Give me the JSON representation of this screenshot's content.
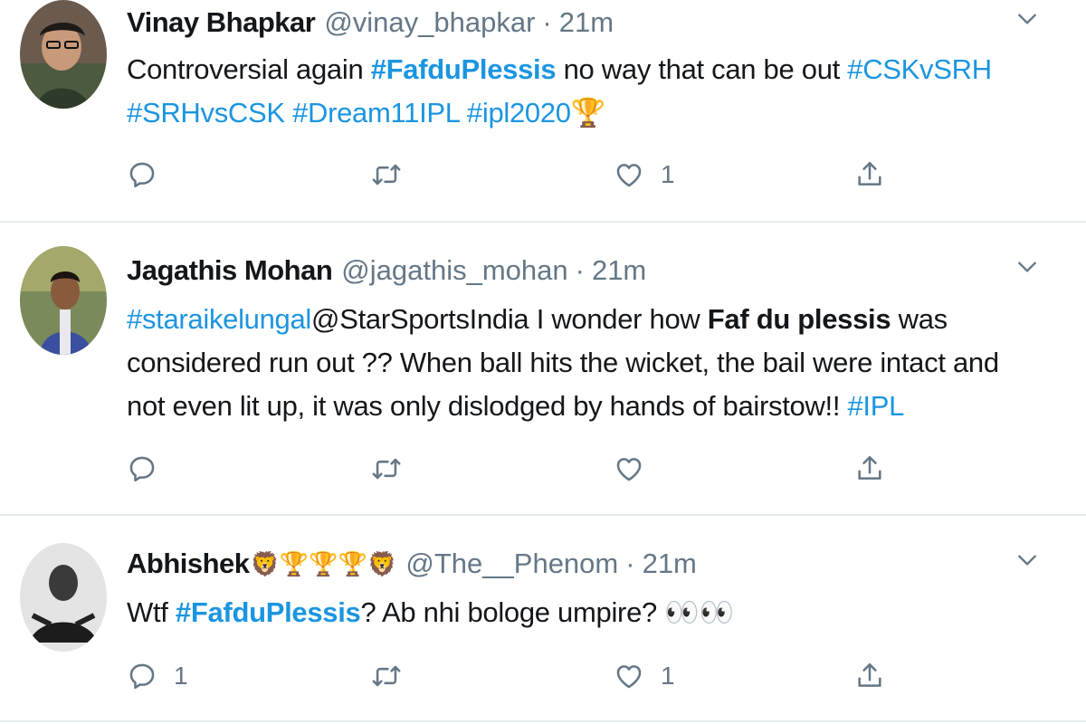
{
  "tweets": [
    {
      "name": "Vinay Bhapkar",
      "name_emoji": "",
      "handle": "@vinay_bhapkar",
      "separator": "·",
      "time": "21m",
      "text": {
        "p1": "Controversial again ",
        "h1": "#FafduPlessis",
        "p2": " no way that can be out ",
        "h2": "#CSKvSRH",
        "h3": "#SRHvsCSK",
        "h4": "#Dream11IPL",
        "h5": "#ipl2020",
        "emoji": "🏆"
      },
      "reply_count": "",
      "retweet_count": "",
      "like_count": "1"
    },
    {
      "name": "Jagathis Mohan",
      "handle": "@jagathis_mohan",
      "separator": "·",
      "time": "21m",
      "text": {
        "h1": "#staraikelungal",
        "mention": "@StarSportsIndia",
        "p1": " I wonder how ",
        "b1": "Faf du plessis",
        "p2": " was considered run out ?? When ball hits the wicket, the bail were intact and not even lit up, it was only dislodged by hands of bairstow!! ",
        "h2": "#IPL"
      },
      "reply_count": "",
      "retweet_count": "",
      "like_count": ""
    },
    {
      "name": "Abhishek",
      "name_emoji": "🦁🏆🏆🏆🦁",
      "handle": "@The__Phenom",
      "separator": "·",
      "time": "21m",
      "text": {
        "p1": "Wtf ",
        "h1": "#FafduPlessis",
        "p2": "? Ab nhi bologe umpire? ",
        "emoji": "👀👀"
      },
      "reply_count": "1",
      "retweet_count": "",
      "like_count": "1"
    }
  ],
  "icons": {
    "reply": "reply-icon",
    "retweet": "retweet-icon",
    "like": "heart-icon",
    "share": "share-icon",
    "caret": "chevron-down-icon"
  },
  "colors": {
    "link": "#1b95e0",
    "secondary": "#657786",
    "text": "#14171a",
    "divider": "#e6ecf0"
  }
}
